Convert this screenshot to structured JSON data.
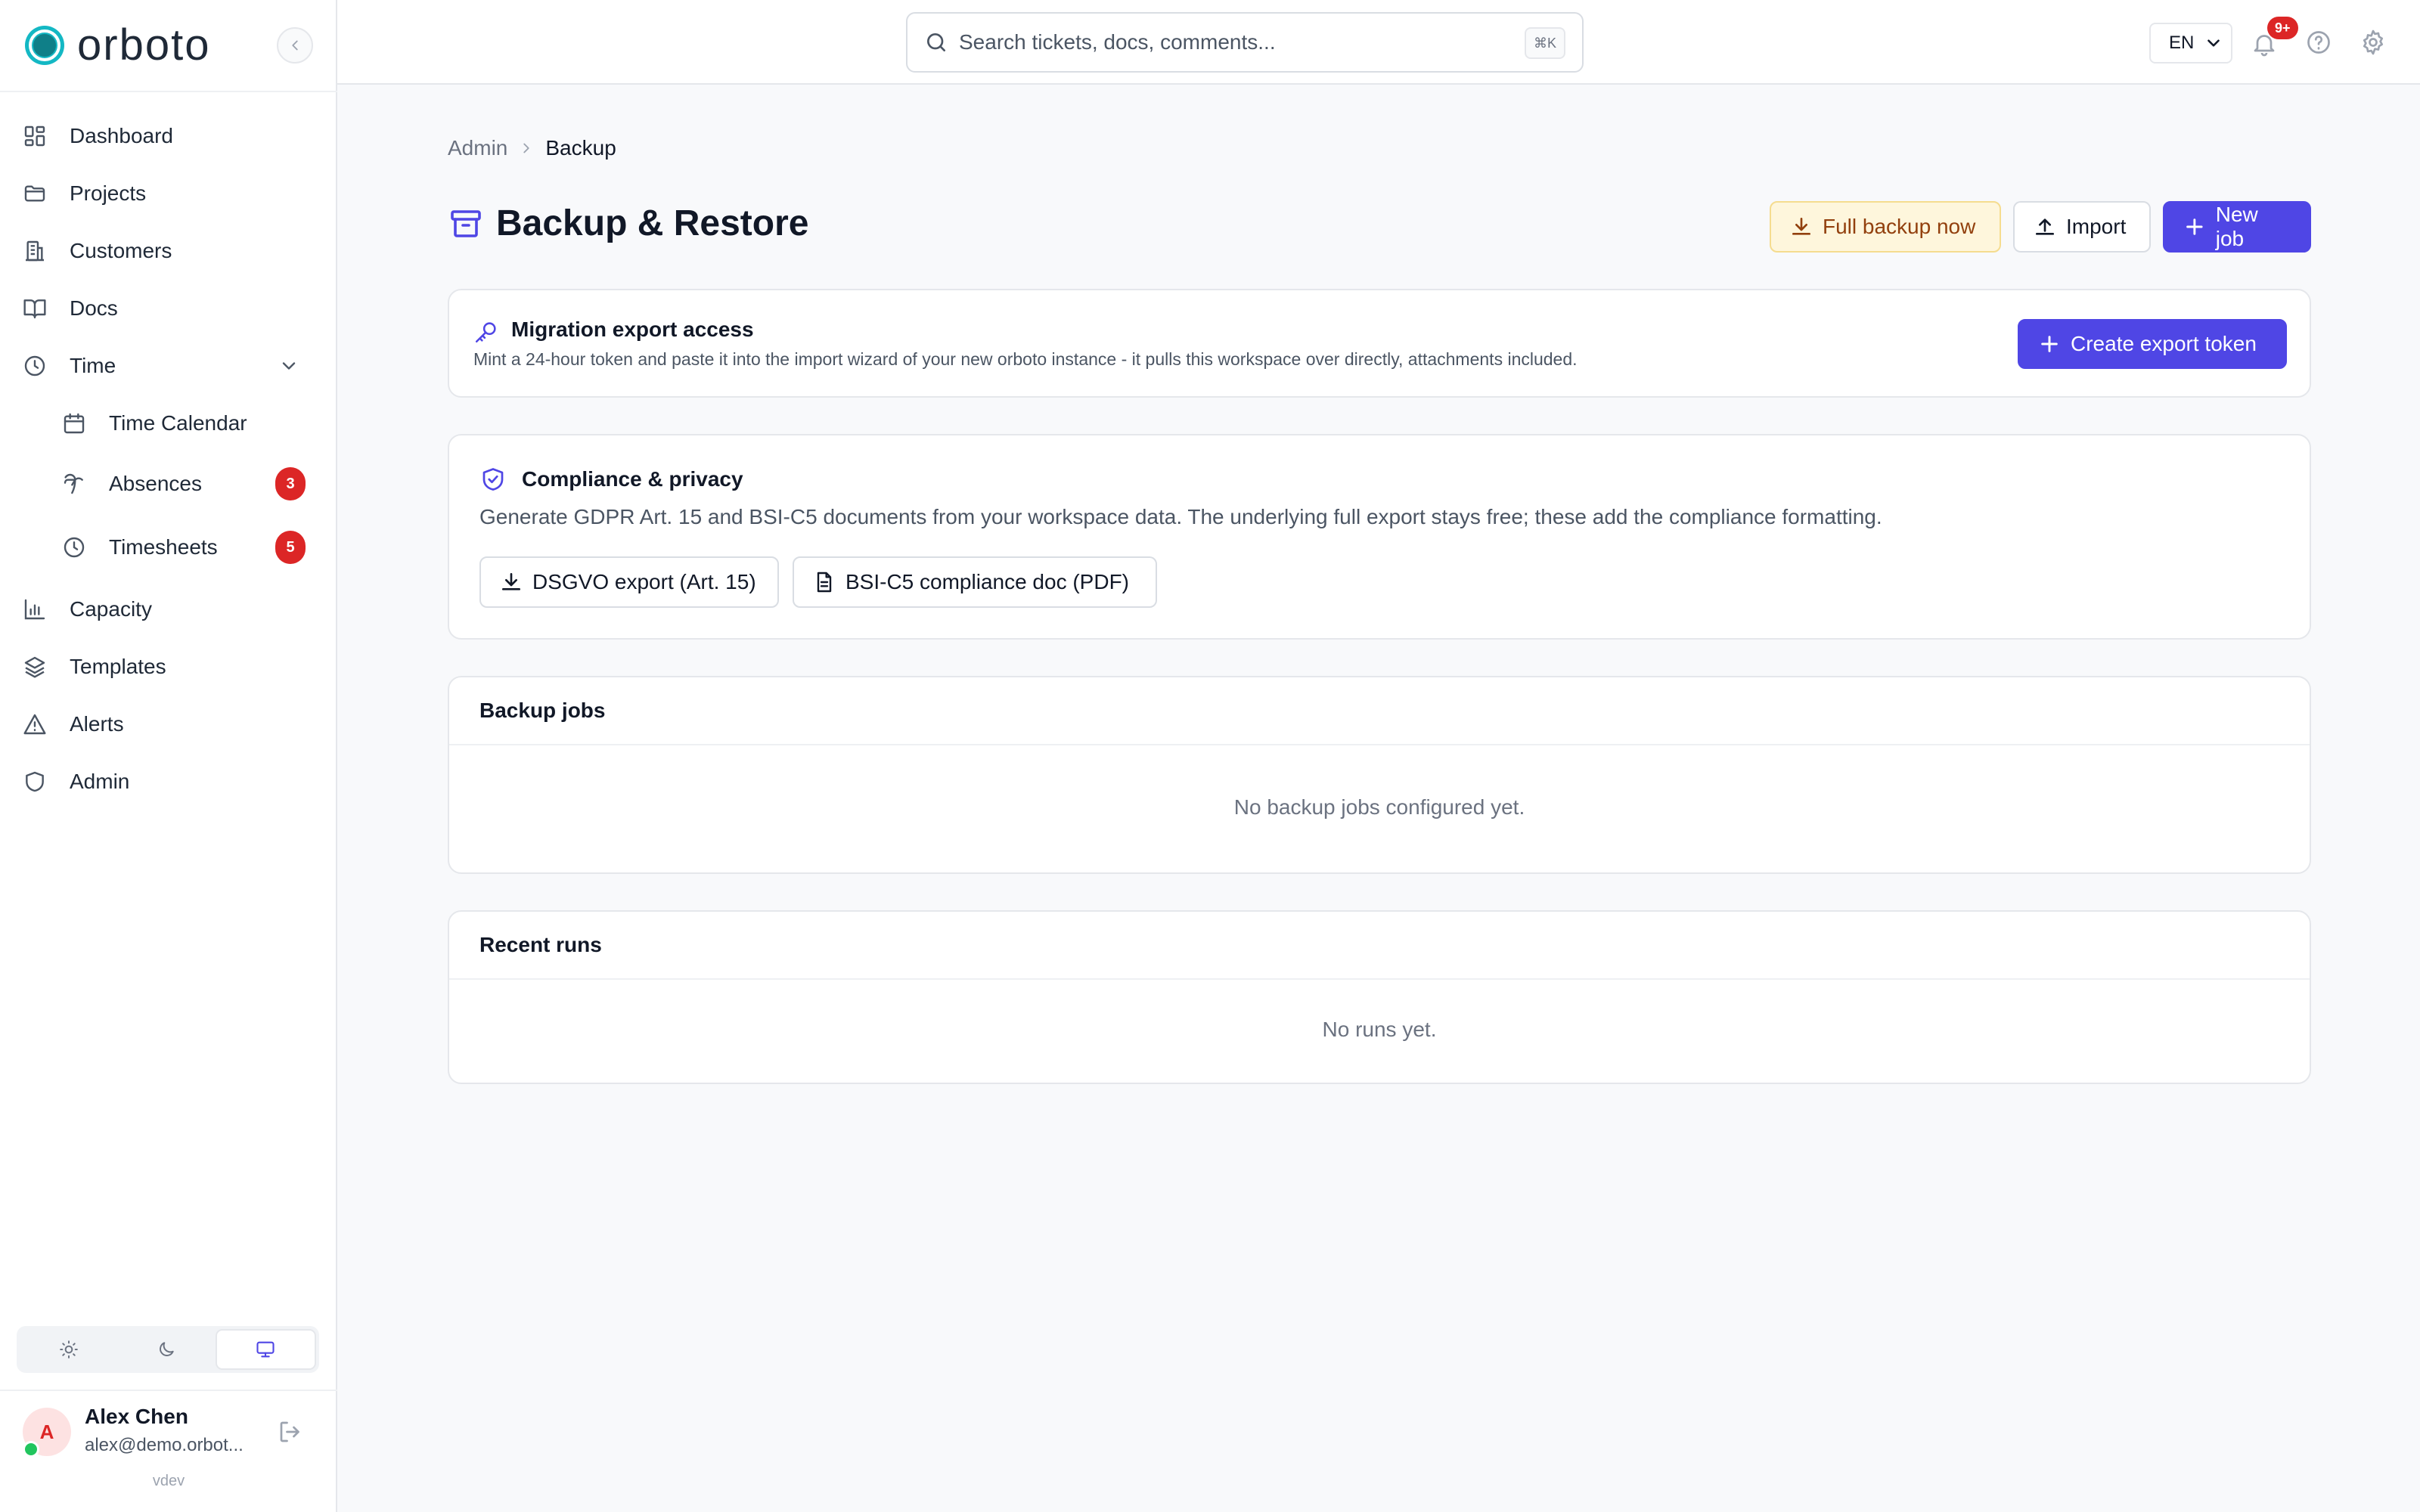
{
  "brand": {
    "name": "orboto",
    "accent": "#14b8c4"
  },
  "sidebar": {
    "items": [
      {
        "label": "Dashboard",
        "icon": "dashboard-icon"
      },
      {
        "label": "Projects",
        "icon": "folder-icon"
      },
      {
        "label": "Customers",
        "icon": "building-icon"
      },
      {
        "label": "Docs",
        "icon": "book-icon"
      },
      {
        "label": "Time",
        "icon": "clock-icon",
        "expanded": true
      },
      {
        "label": "Time Calendar",
        "icon": "calendar-icon"
      },
      {
        "label": "Absences",
        "icon": "palm-tree-icon",
        "badge": "3"
      },
      {
        "label": "Timesheets",
        "icon": "clock-icon",
        "badge": "5"
      },
      {
        "label": "Capacity",
        "icon": "bar-chart-icon"
      },
      {
        "label": "Templates",
        "icon": "layers-icon"
      },
      {
        "label": "Alerts",
        "icon": "alert-triangle-icon"
      },
      {
        "label": "Admin",
        "icon": "shield-icon"
      }
    ],
    "theme": {
      "options": [
        "light",
        "dark",
        "system"
      ],
      "selected": "system"
    },
    "user": {
      "initial": "A",
      "name": "Alex Chen",
      "email": "alex@demo.orbot...",
      "status_color": "#22c55e"
    },
    "version": "vdev"
  },
  "topbar": {
    "search_placeholder": "Search tickets, docs, comments...",
    "shortcut": "⌘K",
    "language": "EN",
    "notifications_badge": "9+"
  },
  "breadcrumb": {
    "parent": "Admin",
    "current": "Backup"
  },
  "page": {
    "title": "Backup & Restore",
    "actions": {
      "full_backup": "Full backup now",
      "import": "Import",
      "new_job": "New job"
    }
  },
  "migration": {
    "title": "Migration export access",
    "description": "Mint a 24-hour token and paste it into the import wizard of your new orboto instance - it pulls this workspace over directly, attachments included.",
    "button": "Create export token"
  },
  "compliance": {
    "title": "Compliance & privacy",
    "description": "Generate GDPR Art. 15 and BSI-C5 documents from your workspace data. The underlying full export stays free; these add the compliance formatting.",
    "dsgvo_button": "DSGVO export (Art. 15)",
    "bsi_button": "BSI-C5 compliance doc (PDF)"
  },
  "backup_jobs": {
    "title": "Backup jobs",
    "empty": "No backup jobs configured yet."
  },
  "recent_runs": {
    "title": "Recent runs",
    "empty": "No runs yet."
  },
  "colors": {
    "primary": "#4f46e5",
    "danger": "#dc2626",
    "warning_bg": "#fef6dc"
  }
}
